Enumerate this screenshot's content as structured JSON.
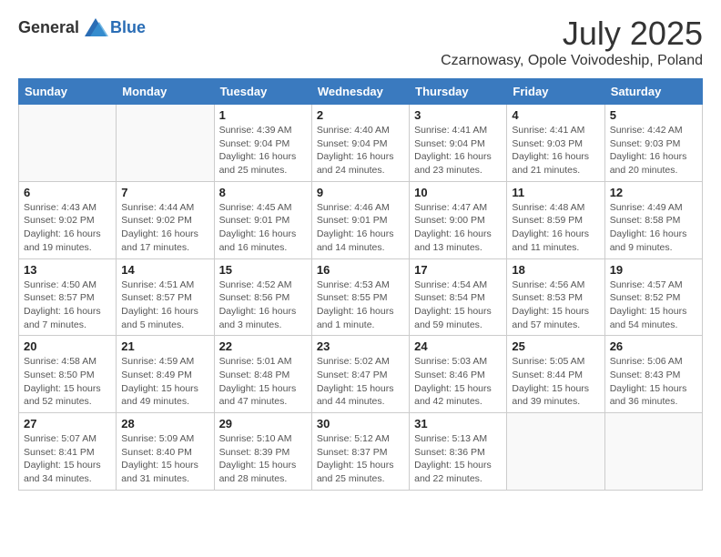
{
  "header": {
    "logo_general": "General",
    "logo_blue": "Blue",
    "month_title": "July 2025",
    "location": "Czarnowasy, Opole Voivodeship, Poland"
  },
  "days_of_week": [
    "Sunday",
    "Monday",
    "Tuesday",
    "Wednesday",
    "Thursday",
    "Friday",
    "Saturday"
  ],
  "weeks": [
    [
      {
        "day": "",
        "info": ""
      },
      {
        "day": "",
        "info": ""
      },
      {
        "day": "1",
        "info": "Sunrise: 4:39 AM\nSunset: 9:04 PM\nDaylight: 16 hours and 25 minutes."
      },
      {
        "day": "2",
        "info": "Sunrise: 4:40 AM\nSunset: 9:04 PM\nDaylight: 16 hours and 24 minutes."
      },
      {
        "day": "3",
        "info": "Sunrise: 4:41 AM\nSunset: 9:04 PM\nDaylight: 16 hours and 23 minutes."
      },
      {
        "day": "4",
        "info": "Sunrise: 4:41 AM\nSunset: 9:03 PM\nDaylight: 16 hours and 21 minutes."
      },
      {
        "day": "5",
        "info": "Sunrise: 4:42 AM\nSunset: 9:03 PM\nDaylight: 16 hours and 20 minutes."
      }
    ],
    [
      {
        "day": "6",
        "info": "Sunrise: 4:43 AM\nSunset: 9:02 PM\nDaylight: 16 hours and 19 minutes."
      },
      {
        "day": "7",
        "info": "Sunrise: 4:44 AM\nSunset: 9:02 PM\nDaylight: 16 hours and 17 minutes."
      },
      {
        "day": "8",
        "info": "Sunrise: 4:45 AM\nSunset: 9:01 PM\nDaylight: 16 hours and 16 minutes."
      },
      {
        "day": "9",
        "info": "Sunrise: 4:46 AM\nSunset: 9:01 PM\nDaylight: 16 hours and 14 minutes."
      },
      {
        "day": "10",
        "info": "Sunrise: 4:47 AM\nSunset: 9:00 PM\nDaylight: 16 hours and 13 minutes."
      },
      {
        "day": "11",
        "info": "Sunrise: 4:48 AM\nSunset: 8:59 PM\nDaylight: 16 hours and 11 minutes."
      },
      {
        "day": "12",
        "info": "Sunrise: 4:49 AM\nSunset: 8:58 PM\nDaylight: 16 hours and 9 minutes."
      }
    ],
    [
      {
        "day": "13",
        "info": "Sunrise: 4:50 AM\nSunset: 8:57 PM\nDaylight: 16 hours and 7 minutes."
      },
      {
        "day": "14",
        "info": "Sunrise: 4:51 AM\nSunset: 8:57 PM\nDaylight: 16 hours and 5 minutes."
      },
      {
        "day": "15",
        "info": "Sunrise: 4:52 AM\nSunset: 8:56 PM\nDaylight: 16 hours and 3 minutes."
      },
      {
        "day": "16",
        "info": "Sunrise: 4:53 AM\nSunset: 8:55 PM\nDaylight: 16 hours and 1 minute."
      },
      {
        "day": "17",
        "info": "Sunrise: 4:54 AM\nSunset: 8:54 PM\nDaylight: 15 hours and 59 minutes."
      },
      {
        "day": "18",
        "info": "Sunrise: 4:56 AM\nSunset: 8:53 PM\nDaylight: 15 hours and 57 minutes."
      },
      {
        "day": "19",
        "info": "Sunrise: 4:57 AM\nSunset: 8:52 PM\nDaylight: 15 hours and 54 minutes."
      }
    ],
    [
      {
        "day": "20",
        "info": "Sunrise: 4:58 AM\nSunset: 8:50 PM\nDaylight: 15 hours and 52 minutes."
      },
      {
        "day": "21",
        "info": "Sunrise: 4:59 AM\nSunset: 8:49 PM\nDaylight: 15 hours and 49 minutes."
      },
      {
        "day": "22",
        "info": "Sunrise: 5:01 AM\nSunset: 8:48 PM\nDaylight: 15 hours and 47 minutes."
      },
      {
        "day": "23",
        "info": "Sunrise: 5:02 AM\nSunset: 8:47 PM\nDaylight: 15 hours and 44 minutes."
      },
      {
        "day": "24",
        "info": "Sunrise: 5:03 AM\nSunset: 8:46 PM\nDaylight: 15 hours and 42 minutes."
      },
      {
        "day": "25",
        "info": "Sunrise: 5:05 AM\nSunset: 8:44 PM\nDaylight: 15 hours and 39 minutes."
      },
      {
        "day": "26",
        "info": "Sunrise: 5:06 AM\nSunset: 8:43 PM\nDaylight: 15 hours and 36 minutes."
      }
    ],
    [
      {
        "day": "27",
        "info": "Sunrise: 5:07 AM\nSunset: 8:41 PM\nDaylight: 15 hours and 34 minutes."
      },
      {
        "day": "28",
        "info": "Sunrise: 5:09 AM\nSunset: 8:40 PM\nDaylight: 15 hours and 31 minutes."
      },
      {
        "day": "29",
        "info": "Sunrise: 5:10 AM\nSunset: 8:39 PM\nDaylight: 15 hours and 28 minutes."
      },
      {
        "day": "30",
        "info": "Sunrise: 5:12 AM\nSunset: 8:37 PM\nDaylight: 15 hours and 25 minutes."
      },
      {
        "day": "31",
        "info": "Sunrise: 5:13 AM\nSunset: 8:36 PM\nDaylight: 15 hours and 22 minutes."
      },
      {
        "day": "",
        "info": ""
      },
      {
        "day": "",
        "info": ""
      }
    ]
  ]
}
